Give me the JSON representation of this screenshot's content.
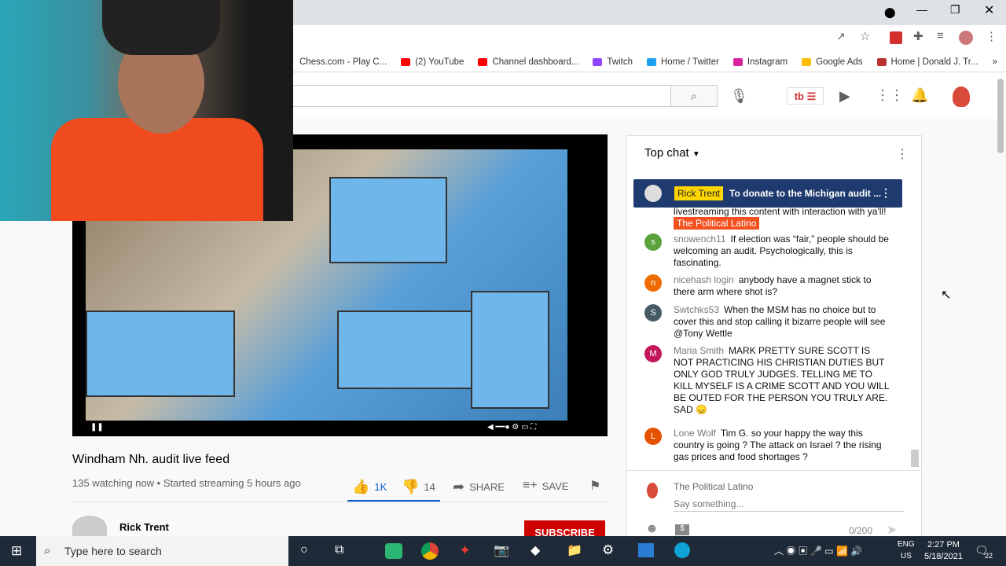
{
  "browser": {
    "bookmarks": [
      "Chess.com - Play C...",
      "(2) YouTube",
      "Channel dashboard...",
      "Twitch",
      "Home / Twitter",
      "Instagram",
      "Google Ads",
      "Home | Donald J. Tr..."
    ],
    "more": "»"
  },
  "video": {
    "title": "Windham Nh. audit live feed",
    "meta": "135 watching now • Started streaming 5 hours ago",
    "likes": "1K",
    "dislikes": "14",
    "share": "SHARE",
    "save": "SAVE"
  },
  "channel": {
    "name": "Rick Trent",
    "subscribe": "SUBSCRIBE"
  },
  "chat": {
    "header": "Top chat",
    "pinned": {
      "author": "Rick Trent",
      "text": "To donate to the Michigan audit ..."
    },
    "partial": "livestreaming this content with interaction with ya'll!",
    "partial_badge": "The Political Latino",
    "messages": [
      {
        "initial": "s",
        "color": "#5ba23a",
        "author": "snowench11",
        "text": "If election was “fair,” people should be welcoming an audit. Psychologically, this is fascinating."
      },
      {
        "initial": "n",
        "color": "#ef6c00",
        "author": "nicehash login",
        "text": "anybody have a magnet stick to there arm where shot is?"
      },
      {
        "initial": "S",
        "color": "#455a64",
        "author": "Swtchks53",
        "text": "When the MSM has no choice but to cover this and stop calling it bizarre people will see @Tony Wettle"
      },
      {
        "initial": "M",
        "color": "#c2185b",
        "author": "Maria Smith",
        "text": "MARK PRETTY SURE SCOTT IS NOT PRACTICING HIS CHRISTIAN DUTIES BUT ONLY GOD TRULY JUDGES. TELLING ME TO KILL MYSELF IS A CRIME SCOTT AND YOU WILL BE OUTED FOR THE PERSON YOU TRULY ARE. SAD 😞"
      },
      {
        "initial": "L",
        "color": "#e65100",
        "author": "Lone Wolf",
        "text": "Tim G. so your happy the way this country is going ? The attack on Israel ? the rising gas prices and food shortages ?"
      }
    ],
    "user": "The Political Latino",
    "placeholder": "Say something...",
    "counter": "0/200"
  },
  "taskbar": {
    "search": "Type here to search",
    "lang": "ENG",
    "region": "US",
    "time": "2:27 PM",
    "date": "5/18/2021",
    "notifications": "22"
  }
}
